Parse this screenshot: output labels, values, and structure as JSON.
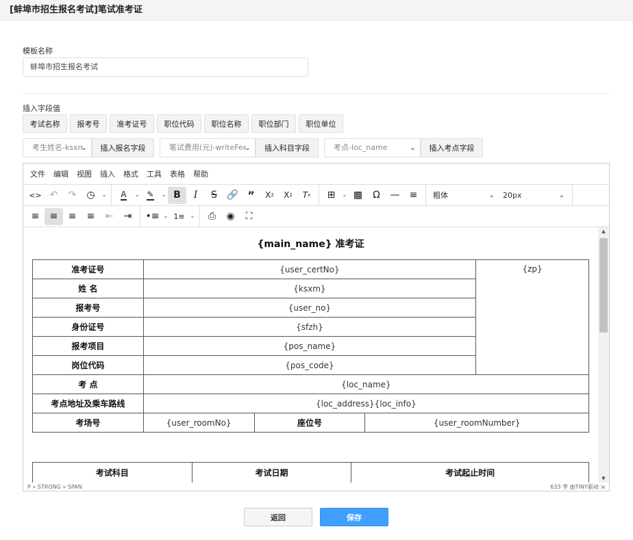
{
  "window": {
    "title": "[蚌埠市招生报名考试]笔试准考证"
  },
  "form": {
    "template_name_label": "模板名称",
    "template_name_value": "蚌埠市招生报名考试",
    "insert_field_label": "插入字段值",
    "field_buttons": [
      "考试名称",
      "报考号",
      "准考证号",
      "职位代码",
      "职位名称",
      "职位部门",
      "职位单位"
    ],
    "selects": [
      {
        "value": "考生姓名-ksxm",
        "button": "插入报名字段"
      },
      {
        "value": "笔试费用(元)-writeFee",
        "button": "插入科目字段"
      },
      {
        "value": "考点-loc_name",
        "button": "插入考点字段"
      }
    ]
  },
  "editor": {
    "menu": [
      "文件",
      "编辑",
      "视图",
      "插入",
      "格式",
      "工具",
      "表格",
      "帮助"
    ],
    "font_weight_dropdown": "粗体",
    "font_size_dropdown": "20px",
    "icons_row1": [
      "source-code-icon",
      "undo-icon",
      "redo-icon",
      "history-icon",
      "font-color-icon",
      "highlight-icon",
      "bold-icon",
      "italic-icon",
      "strikethrough-icon",
      "link-icon",
      "blockquote-icon",
      "subscript-icon",
      "superscript-icon",
      "clear-format-icon",
      "table-icon",
      "image-icon",
      "special-char-icon",
      "horizontal-rule-icon",
      "page-break-icon"
    ],
    "icons_row2": [
      "align-left-icon",
      "align-center-icon",
      "align-right-icon",
      "align-justify-icon",
      "outdent-icon",
      "indent-icon",
      "bullet-list-icon",
      "number-list-icon",
      "print-icon",
      "preview-icon",
      "fullscreen-icon"
    ],
    "document": {
      "title": "{main_name} 准考证",
      "rows": [
        {
          "label": "准考证号",
          "value": "{user_certNo}"
        },
        {
          "label": "姓  名",
          "value": "{ksxm}"
        },
        {
          "label": "报考号",
          "value": "{user_no}"
        },
        {
          "label": "身份证号",
          "value": "{sfzh}"
        },
        {
          "label": "报考项目",
          "value": "{pos_name}"
        },
        {
          "label": "岗位代码",
          "value": "{pos_code}"
        }
      ],
      "photo": "{zp}",
      "loc_label": "考  点",
      "loc_value": "{loc_name}",
      "addr_label": "考点地址及乘车路线",
      "addr_value": "{loc_address}{loc_info}",
      "room_label": "考场号",
      "room_value": "{user_roomNo}",
      "seat_label": "座位号",
      "seat_value": "{user_roomNumber}",
      "subject_headers": [
        "考试科目",
        "考试日期",
        "考试起止时间"
      ]
    },
    "status_path": "P » STRONG » SPAN",
    "word_count": "633 字",
    "powered_by": "由TINY驱动"
  },
  "actions": {
    "back": "返回",
    "save": "保存"
  },
  "colors": {
    "primary": "#409eff",
    "border": "#dcdfe6"
  }
}
